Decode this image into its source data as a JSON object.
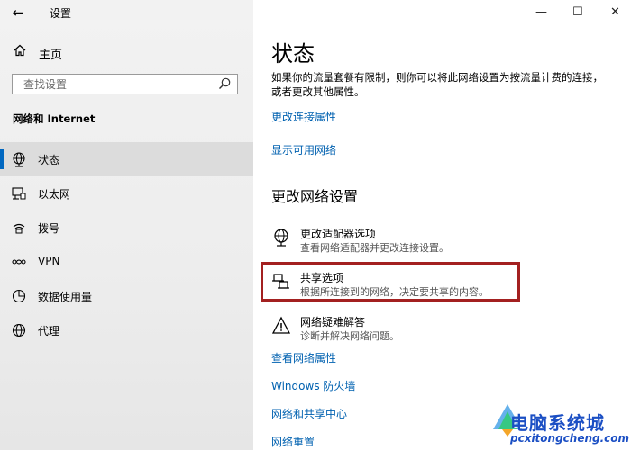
{
  "app": {
    "title": "设置"
  },
  "sidebar": {
    "home_label": "主页",
    "search_placeholder": "查找设置",
    "section_title": "网络和 Internet",
    "items": [
      {
        "label": "状态",
        "icon": "globe-status-icon",
        "active": true
      },
      {
        "label": "以太网",
        "icon": "ethernet-icon",
        "active": false
      },
      {
        "label": "拨号",
        "icon": "dialup-icon",
        "active": false
      },
      {
        "label": "VPN",
        "icon": "vpn-icon",
        "active": false
      },
      {
        "label": "数据使用量",
        "icon": "data-usage-icon",
        "active": false
      },
      {
        "label": "代理",
        "icon": "proxy-globe-icon",
        "active": false
      }
    ]
  },
  "main": {
    "title": "状态",
    "description": "如果你的流量套餐有限制，则你可以将此网络设置为按流量计费的连接，或者更改其他属性。",
    "links_top": [
      "更改连接属性",
      "显示可用网络"
    ],
    "section_heading": "更改网络设置",
    "options": [
      {
        "title": "更改适配器选项",
        "subtitle": "查看网络适配器并更改连接设置。"
      },
      {
        "title": "共享选项",
        "subtitle": "根据所连接到的网络，决定要共享的内容。"
      },
      {
        "title": "网络疑难解答",
        "subtitle": "诊断并解决网络问题。"
      }
    ],
    "links_bottom": [
      "查看网络属性",
      "Windows 防火墙",
      "网络和共享中心",
      "网络重置"
    ]
  },
  "window_controls": {
    "minimize": "—",
    "maximize": "☐",
    "close": "✕"
  },
  "watermark": {
    "title": "电脑系统城",
    "url": "pcxitongcheng.com"
  },
  "colors": {
    "accent": "#0067c0",
    "link": "#0061b0",
    "highlight_border": "#a32020",
    "watermark": "#1b4fc4"
  }
}
